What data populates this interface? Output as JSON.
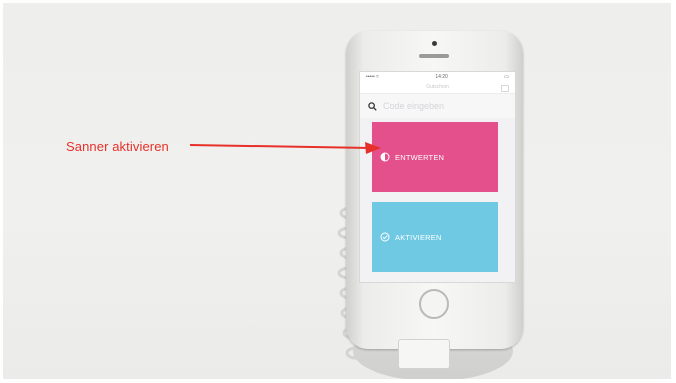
{
  "annotation": {
    "label": "Sanner aktivieren",
    "color": "#e8302a"
  },
  "app": {
    "status": {
      "carrier": "••••• ≈",
      "time": "14:20",
      "battery": "▭"
    },
    "nav_title": "Gutschein",
    "search": {
      "placeholder": "Code eingeben",
      "icon": "search-icon"
    },
    "tiles": [
      {
        "label": "ENTWERTEN",
        "icon": "half-circle-icon",
        "color": "#e4508c"
      },
      {
        "label": "AKTIVIEREN",
        "icon": "check-circle-icon",
        "color": "#6fc9e3"
      }
    ]
  }
}
